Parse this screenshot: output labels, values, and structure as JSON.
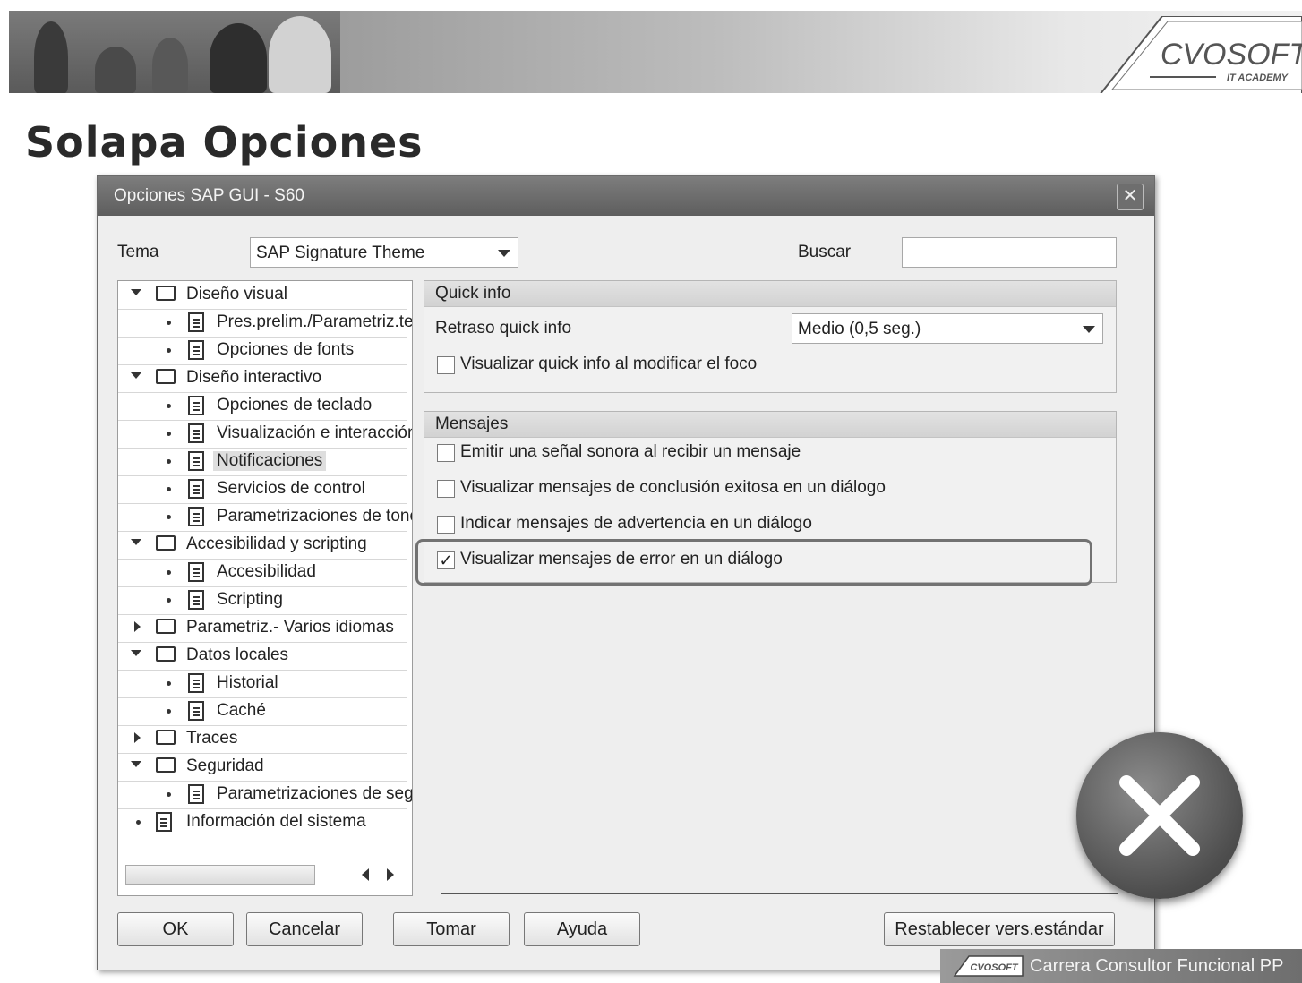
{
  "slide": {
    "title": "Solapa Opciones",
    "logo_text": "CVOSOFT",
    "logo_subtext": "IT ACADEMY",
    "footer_text": "Carrera Consultor Funcional PP",
    "footer_logo": "CVOSOFT"
  },
  "dialog": {
    "title": "Opciones SAP GUI - S60",
    "close_icon": "close-icon",
    "tema_label": "Tema",
    "tema_value": "SAP Signature Theme",
    "buscar_label": "Buscar",
    "buscar_value": ""
  },
  "tree": {
    "items": [
      {
        "label": "Diseño visual",
        "type": "folder",
        "state": "open"
      },
      {
        "label": "Pres.prelim./Parametriz.te",
        "type": "doc"
      },
      {
        "label": "Opciones de fonts",
        "type": "doc"
      },
      {
        "label": "Diseño interactivo",
        "type": "folder",
        "state": "open"
      },
      {
        "label": "Opciones de teclado",
        "type": "doc"
      },
      {
        "label": "Visualización e interacción",
        "type": "doc"
      },
      {
        "label": "Notificaciones",
        "type": "doc",
        "selected": true
      },
      {
        "label": "Servicios de control",
        "type": "doc"
      },
      {
        "label": "Parametrizaciones de tono",
        "type": "doc"
      },
      {
        "label": "Accesibilidad y scripting",
        "type": "folder",
        "state": "open"
      },
      {
        "label": "Accesibilidad",
        "type": "doc"
      },
      {
        "label": "Scripting",
        "type": "doc"
      },
      {
        "label": "Parametriz.- Varios idiomas",
        "type": "folder",
        "state": "closed"
      },
      {
        "label": "Datos locales",
        "type": "folder",
        "state": "open"
      },
      {
        "label": "Historial",
        "type": "doc"
      },
      {
        "label": "Caché",
        "type": "doc"
      },
      {
        "label": "Traces",
        "type": "folder",
        "state": "closed"
      },
      {
        "label": "Seguridad",
        "type": "folder",
        "state": "open"
      },
      {
        "label": "Parametrizaciones de seg",
        "type": "doc"
      },
      {
        "label": "Información del sistema",
        "type": "doc"
      }
    ]
  },
  "quick_info": {
    "header": "Quick info",
    "retraso_label": "Retraso quick info",
    "retraso_value": "Medio (0,5 seg.)",
    "cb1_label": "Visualizar quick info al modificar el foco",
    "cb1_checked": false
  },
  "mensajes": {
    "header": "Mensajes",
    "options": [
      {
        "label": "Emitir una señal sonora al recibir un mensaje",
        "checked": false
      },
      {
        "label": "Visualizar mensajes de conclusión exitosa en un diálogo",
        "checked": false
      },
      {
        "label": "Indicar mensajes de advertencia en un diálogo",
        "checked": false
      },
      {
        "label": "Visualizar mensajes de error en un diálogo",
        "checked": true
      }
    ]
  },
  "buttons": {
    "ok": "OK",
    "cancelar": "Cancelar",
    "tomar": "Tomar",
    "ayuda": "Ayuda",
    "restablecer": "Restablecer vers.estándar"
  },
  "colors": {
    "dialog_bg": "#eeeeee",
    "titlebar": "#6a6a6a",
    "big_x_circle": "#555555"
  }
}
